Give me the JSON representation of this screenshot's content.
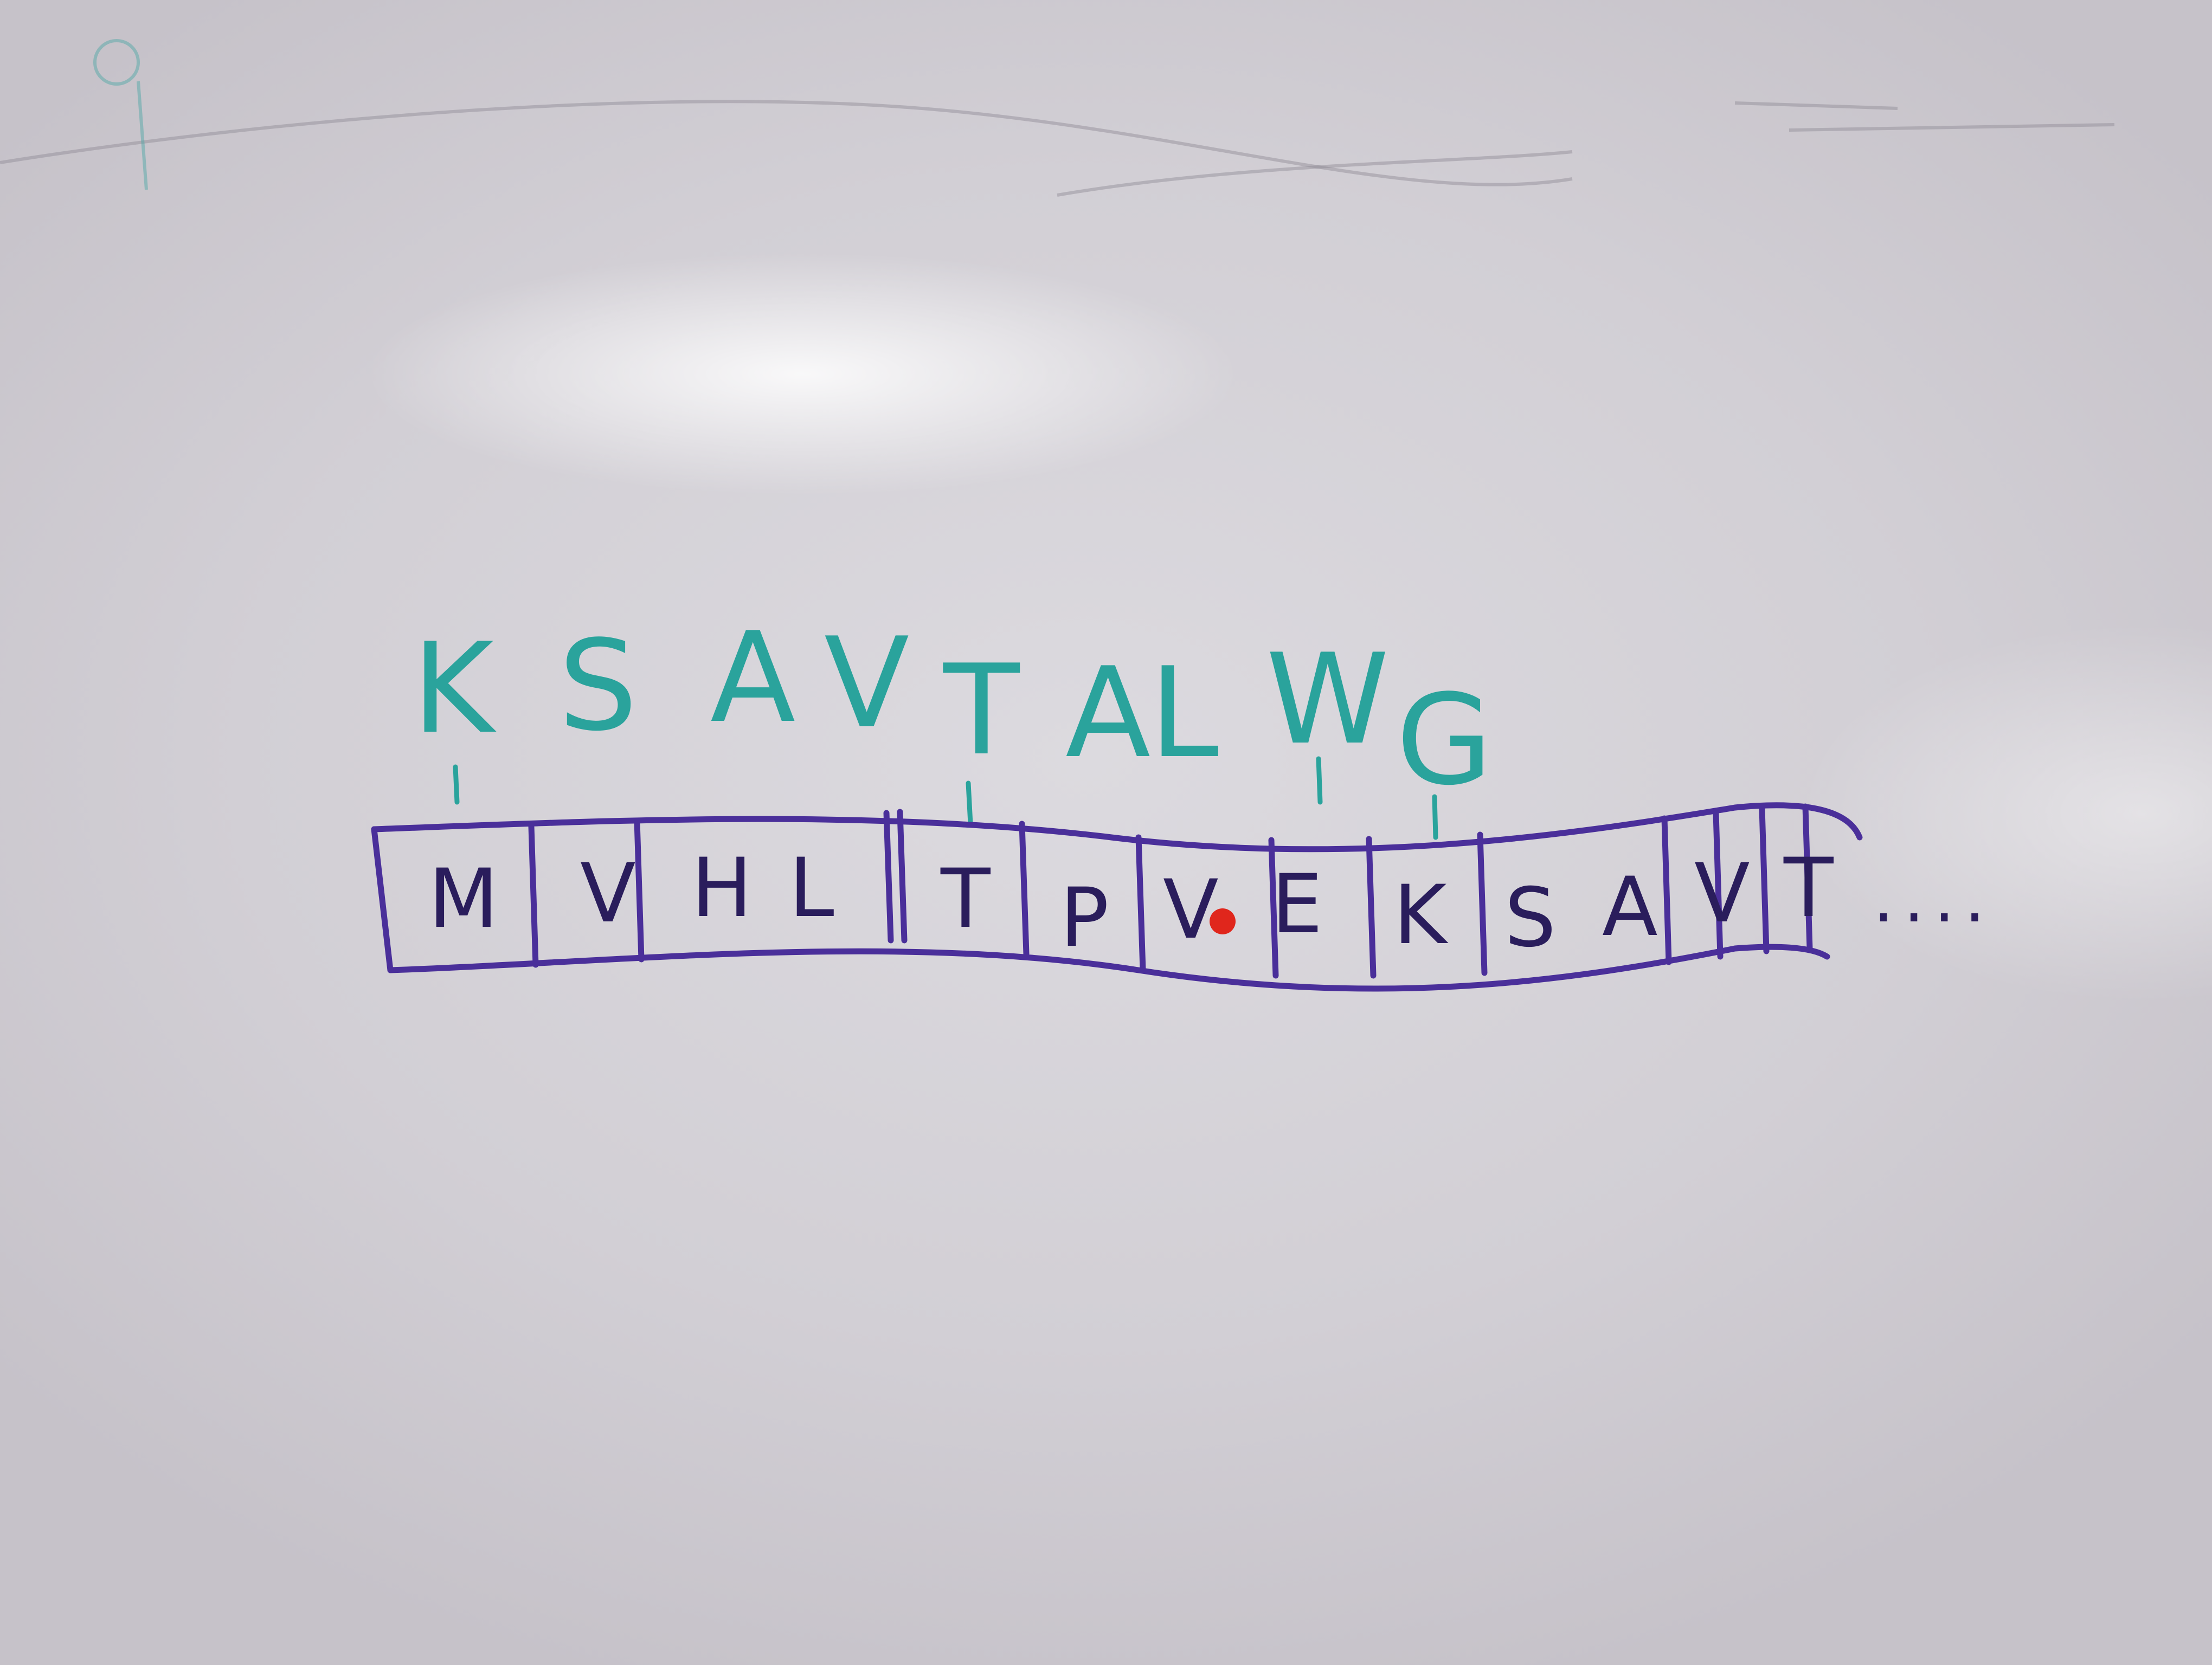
{
  "colors": {
    "board": "#d6d3d9",
    "teal_marker": "#2aa39c",
    "purple_marker": "#4a2f9a",
    "black_ink": "#2a1d5c",
    "red_dot": "#e0261c"
  },
  "key_letters": [
    "K",
    "S",
    "A",
    "V",
    "T",
    "A",
    "L",
    "W",
    "G"
  ],
  "tape_cells": [
    "M",
    "V",
    "H",
    "L",
    "T",
    "P",
    "V",
    "E",
    "K",
    "S",
    "A",
    "V",
    "T"
  ],
  "continuation": "....",
  "marked_cell_index": 6
}
